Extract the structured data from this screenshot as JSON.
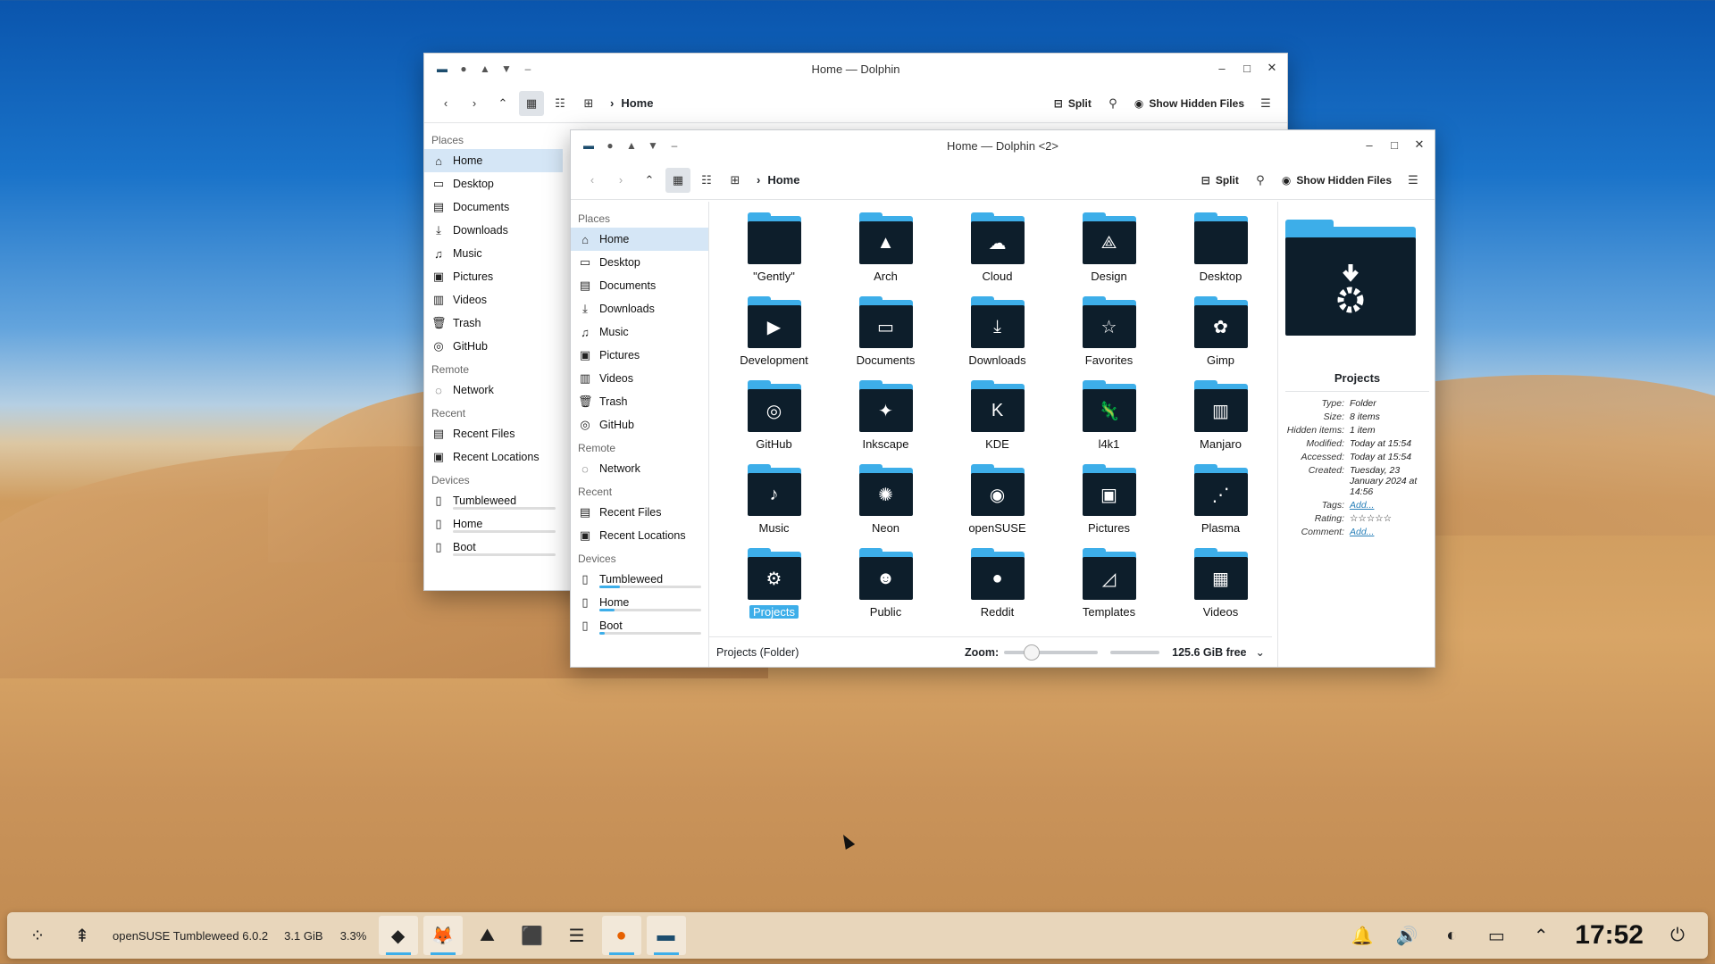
{
  "back_window": {
    "title": "Home — Dolphin",
    "breadcrumb": "Home",
    "split_label": "Split",
    "hidden_label": "Show Hidden Files",
    "sidebar": {
      "places_header": "Places",
      "places": [
        {
          "label": "Home",
          "icon": "home-icon"
        },
        {
          "label": "Desktop",
          "icon": "desktop-icon"
        },
        {
          "label": "Documents",
          "icon": "documents-icon"
        },
        {
          "label": "Downloads",
          "icon": "downloads-icon"
        },
        {
          "label": "Music",
          "icon": "music-icon"
        },
        {
          "label": "Pictures",
          "icon": "pictures-icon"
        },
        {
          "label": "Videos",
          "icon": "videos-icon"
        },
        {
          "label": "Trash",
          "icon": "trash-icon"
        },
        {
          "label": "GitHub",
          "icon": "github-icon"
        }
      ],
      "remote_header": "Remote",
      "network": "Network",
      "recent_header": "Recent",
      "recent_files": "Recent Files",
      "recent_locations": "Recent Locations",
      "devices_header": "Devices",
      "devices": [
        "Tumbleweed",
        "Home",
        "Boot"
      ]
    }
  },
  "front_window": {
    "title": "Home — Dolphin <2>",
    "breadcrumb": "Home",
    "split_label": "Split",
    "hidden_label": "Show Hidden Files",
    "sidebar": {
      "places_header": "Places",
      "places": [
        "Home",
        "Desktop",
        "Documents",
        "Downloads",
        "Music",
        "Pictures",
        "Videos",
        "Trash",
        "GitHub"
      ],
      "remote_header": "Remote",
      "network": "Network",
      "recent_header": "Recent",
      "recent_files": "Recent Files",
      "recent_locations": "Recent Locations",
      "devices_header": "Devices",
      "devices": [
        {
          "label": "Tumbleweed",
          "usage": 0.2
        },
        {
          "label": "Home",
          "usage": 0.15
        },
        {
          "label": "Boot",
          "usage": 0.05
        }
      ]
    },
    "files": [
      "\"Gently\"",
      "Arch",
      "Cloud",
      "Design",
      "Desktop",
      "Development",
      "Documents",
      "Downloads",
      "Favorites",
      "Gimp",
      "GitHub",
      "Inkscape",
      "KDE",
      "l4k1",
      "Manjaro",
      "Music",
      "Neon",
      "openSUSE",
      "Pictures",
      "Plasma",
      "Projects",
      "Public",
      "Reddit",
      "Templates",
      "Videos"
    ],
    "selected_file": "Projects",
    "status": {
      "text": "Projects (Folder)",
      "zoom_label": "Zoom:",
      "free": "125.6 GiB free"
    },
    "info": {
      "name": "Projects",
      "rows": [
        {
          "k": "Type:",
          "v": "Folder"
        },
        {
          "k": "Size:",
          "v": "8 items"
        },
        {
          "k": "Hidden items:",
          "v": "1 item"
        },
        {
          "k": "Modified:",
          "v": "Today at 15:54"
        },
        {
          "k": "Accessed:",
          "v": "Today at 15:54"
        },
        {
          "k": "Created:",
          "v": "Tuesday, 23 January 2024 at 14:56"
        },
        {
          "k": "Tags:",
          "v": "Add..."
        },
        {
          "k": "Rating:",
          "v": "☆☆☆☆☆"
        },
        {
          "k": "Comment:",
          "v": "Add..."
        }
      ]
    }
  },
  "taskbar": {
    "system_name": "openSUSE Tumbleweed 6.0.2",
    "memory": "3.1 GiB",
    "cpu": "3.3%",
    "clock": "17:52"
  },
  "colors": {
    "accent": "#3daee9",
    "selection": "#d5e6f6",
    "folder_dark": "#0d1e2b"
  }
}
